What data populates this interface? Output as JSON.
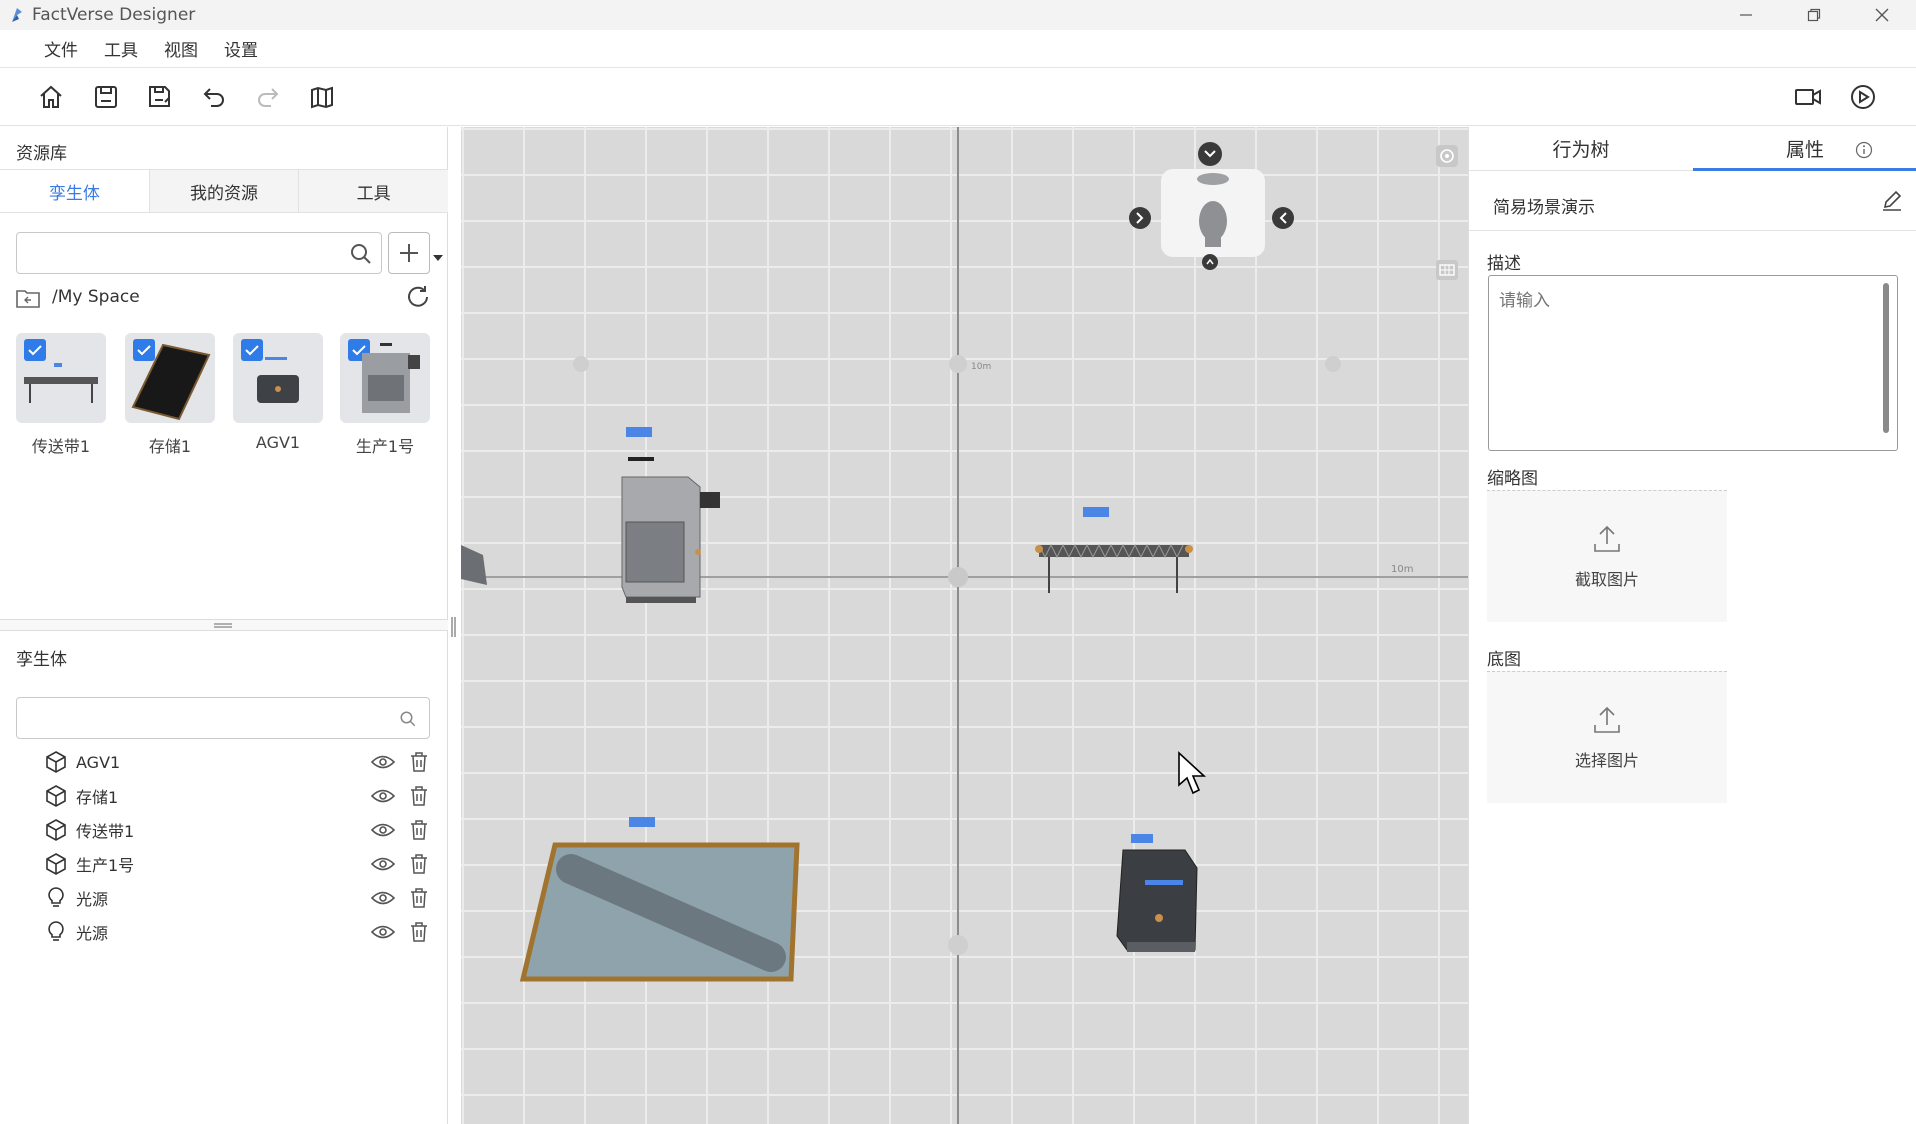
{
  "app": {
    "title": "FactVerse Designer"
  },
  "menu": [
    "文件",
    "工具",
    "视图",
    "设置"
  ],
  "resource_panel": {
    "title": "资源库",
    "tabs": [
      "孪生体",
      "我的资源",
      "工具"
    ],
    "path": "/My Space",
    "items": [
      {
        "label": "传送带1"
      },
      {
        "label": "存储1"
      },
      {
        "label": "AGV1"
      },
      {
        "label": "生产1号"
      }
    ]
  },
  "twin_panel": {
    "title": "孪生体",
    "items": [
      {
        "label": "AGV1",
        "icon": "cube-icon"
      },
      {
        "label": "存储1",
        "icon": "cube-icon"
      },
      {
        "label": "传送带1",
        "icon": "cube-icon"
      },
      {
        "label": "生产1号",
        "icon": "cube-icon"
      },
      {
        "label": "光源",
        "icon": "bulb-icon"
      },
      {
        "label": "光源",
        "icon": "bulb-icon"
      }
    ]
  },
  "viewport": {
    "axis_labels": [
      "10m",
      "10m"
    ]
  },
  "right_panel": {
    "tabs": [
      "行为树",
      "属性"
    ],
    "scene_name": "简易场景演示",
    "description_label": "描述",
    "description_placeholder": "请输入",
    "thumbnail_label": "缩略图",
    "thumbnail_button": "截取图片",
    "basemap_label": "底图",
    "basemap_button": "选择图片"
  },
  "colors": {
    "accent": "#3a7be6",
    "grid_bg": "#dcdcdc"
  }
}
